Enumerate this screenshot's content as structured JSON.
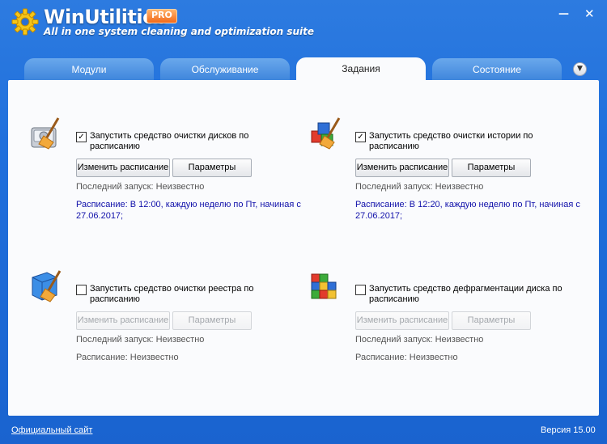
{
  "app": {
    "name": "WinUtilities",
    "badge": "PRO",
    "subtitle": "All in one system cleaning and optimization suite"
  },
  "window_controls": {
    "minimize": "—",
    "close": "✕"
  },
  "tabs": [
    {
      "label": "Модули",
      "active": false
    },
    {
      "label": "Обслуживание",
      "active": false
    },
    {
      "label": "Задания",
      "active": true
    },
    {
      "label": "Состояние",
      "active": false
    }
  ],
  "tab_menu_icon": "▼",
  "tasks": [
    {
      "icon": "disk-cleanup-icon",
      "checked": true,
      "check_mark": "✓",
      "label": "Запустить средство очистки дисков по расписанию",
      "schedule_button": "Изменить расписание",
      "params_button": "Параметры",
      "buttons_enabled": true,
      "last_run": "Последний запуск: Неизвестно",
      "schedule": "Расписание: В 12:00, каждую неделю по Пт, начиная с 27.06.2017;"
    },
    {
      "icon": "history-cleanup-icon",
      "checked": true,
      "check_mark": "✓",
      "label": "Запустить средство очистки истории по расписанию",
      "schedule_button": "Изменить расписание",
      "params_button": "Параметры",
      "buttons_enabled": true,
      "last_run": "Последний запуск: Неизвестно",
      "schedule": "Расписание: В 12:20, каждую неделю по Пт, начиная с 27.06.2017;"
    },
    {
      "icon": "registry-cleanup-icon",
      "checked": false,
      "check_mark": "",
      "label": "Запустить средство очистки реестра по расписанию",
      "schedule_button": "Изменить расписание",
      "params_button": "Параметры",
      "buttons_enabled": false,
      "last_run": "Последний запуск: Неизвестно",
      "schedule": "Расписание: Неизвестно"
    },
    {
      "icon": "defrag-icon",
      "checked": false,
      "check_mark": "",
      "label": "Запустить средство дефрагментации диска по расписанию",
      "schedule_button": "Изменить расписание",
      "params_button": "Параметры",
      "buttons_enabled": false,
      "last_run": "Последний запуск: Неизвестно",
      "schedule": "Расписание: Неизвестно"
    }
  ],
  "footer": {
    "link": "Официальный сайт",
    "version": "Версия 15.00"
  }
}
